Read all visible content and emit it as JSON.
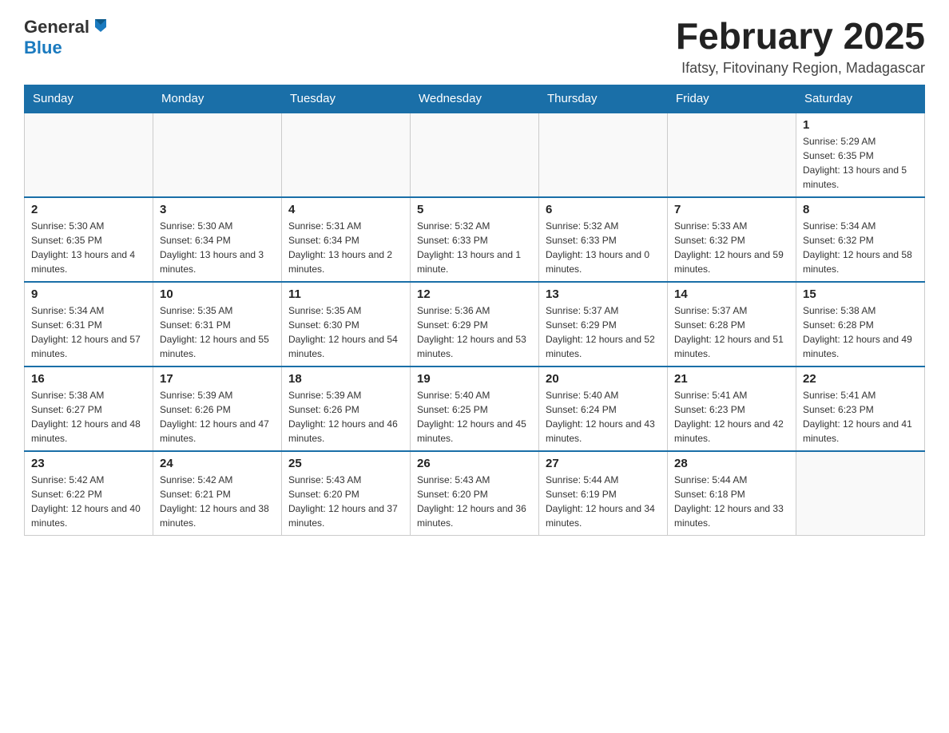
{
  "header": {
    "logo": {
      "general": "General",
      "blue": "Blue"
    },
    "title": "February 2025",
    "location": "Ifatsy, Fitovinany Region, Madagascar"
  },
  "calendar": {
    "days_of_week": [
      "Sunday",
      "Monday",
      "Tuesday",
      "Wednesday",
      "Thursday",
      "Friday",
      "Saturday"
    ],
    "weeks": [
      {
        "days": [
          {
            "date": "",
            "info": ""
          },
          {
            "date": "",
            "info": ""
          },
          {
            "date": "",
            "info": ""
          },
          {
            "date": "",
            "info": ""
          },
          {
            "date": "",
            "info": ""
          },
          {
            "date": "",
            "info": ""
          },
          {
            "date": "1",
            "info": "Sunrise: 5:29 AM\nSunset: 6:35 PM\nDaylight: 13 hours and 5 minutes."
          }
        ]
      },
      {
        "days": [
          {
            "date": "2",
            "info": "Sunrise: 5:30 AM\nSunset: 6:35 PM\nDaylight: 13 hours and 4 minutes."
          },
          {
            "date": "3",
            "info": "Sunrise: 5:30 AM\nSunset: 6:34 PM\nDaylight: 13 hours and 3 minutes."
          },
          {
            "date": "4",
            "info": "Sunrise: 5:31 AM\nSunset: 6:34 PM\nDaylight: 13 hours and 2 minutes."
          },
          {
            "date": "5",
            "info": "Sunrise: 5:32 AM\nSunset: 6:33 PM\nDaylight: 13 hours and 1 minute."
          },
          {
            "date": "6",
            "info": "Sunrise: 5:32 AM\nSunset: 6:33 PM\nDaylight: 13 hours and 0 minutes."
          },
          {
            "date": "7",
            "info": "Sunrise: 5:33 AM\nSunset: 6:32 PM\nDaylight: 12 hours and 59 minutes."
          },
          {
            "date": "8",
            "info": "Sunrise: 5:34 AM\nSunset: 6:32 PM\nDaylight: 12 hours and 58 minutes."
          }
        ]
      },
      {
        "days": [
          {
            "date": "9",
            "info": "Sunrise: 5:34 AM\nSunset: 6:31 PM\nDaylight: 12 hours and 57 minutes."
          },
          {
            "date": "10",
            "info": "Sunrise: 5:35 AM\nSunset: 6:31 PM\nDaylight: 12 hours and 55 minutes."
          },
          {
            "date": "11",
            "info": "Sunrise: 5:35 AM\nSunset: 6:30 PM\nDaylight: 12 hours and 54 minutes."
          },
          {
            "date": "12",
            "info": "Sunrise: 5:36 AM\nSunset: 6:29 PM\nDaylight: 12 hours and 53 minutes."
          },
          {
            "date": "13",
            "info": "Sunrise: 5:37 AM\nSunset: 6:29 PM\nDaylight: 12 hours and 52 minutes."
          },
          {
            "date": "14",
            "info": "Sunrise: 5:37 AM\nSunset: 6:28 PM\nDaylight: 12 hours and 51 minutes."
          },
          {
            "date": "15",
            "info": "Sunrise: 5:38 AM\nSunset: 6:28 PM\nDaylight: 12 hours and 49 minutes."
          }
        ]
      },
      {
        "days": [
          {
            "date": "16",
            "info": "Sunrise: 5:38 AM\nSunset: 6:27 PM\nDaylight: 12 hours and 48 minutes."
          },
          {
            "date": "17",
            "info": "Sunrise: 5:39 AM\nSunset: 6:26 PM\nDaylight: 12 hours and 47 minutes."
          },
          {
            "date": "18",
            "info": "Sunrise: 5:39 AM\nSunset: 6:26 PM\nDaylight: 12 hours and 46 minutes."
          },
          {
            "date": "19",
            "info": "Sunrise: 5:40 AM\nSunset: 6:25 PM\nDaylight: 12 hours and 45 minutes."
          },
          {
            "date": "20",
            "info": "Sunrise: 5:40 AM\nSunset: 6:24 PM\nDaylight: 12 hours and 43 minutes."
          },
          {
            "date": "21",
            "info": "Sunrise: 5:41 AM\nSunset: 6:23 PM\nDaylight: 12 hours and 42 minutes."
          },
          {
            "date": "22",
            "info": "Sunrise: 5:41 AM\nSunset: 6:23 PM\nDaylight: 12 hours and 41 minutes."
          }
        ]
      },
      {
        "days": [
          {
            "date": "23",
            "info": "Sunrise: 5:42 AM\nSunset: 6:22 PM\nDaylight: 12 hours and 40 minutes."
          },
          {
            "date": "24",
            "info": "Sunrise: 5:42 AM\nSunset: 6:21 PM\nDaylight: 12 hours and 38 minutes."
          },
          {
            "date": "25",
            "info": "Sunrise: 5:43 AM\nSunset: 6:20 PM\nDaylight: 12 hours and 37 minutes."
          },
          {
            "date": "26",
            "info": "Sunrise: 5:43 AM\nSunset: 6:20 PM\nDaylight: 12 hours and 36 minutes."
          },
          {
            "date": "27",
            "info": "Sunrise: 5:44 AM\nSunset: 6:19 PM\nDaylight: 12 hours and 34 minutes."
          },
          {
            "date": "28",
            "info": "Sunrise: 5:44 AM\nSunset: 6:18 PM\nDaylight: 12 hours and 33 minutes."
          },
          {
            "date": "",
            "info": ""
          }
        ]
      }
    ]
  }
}
